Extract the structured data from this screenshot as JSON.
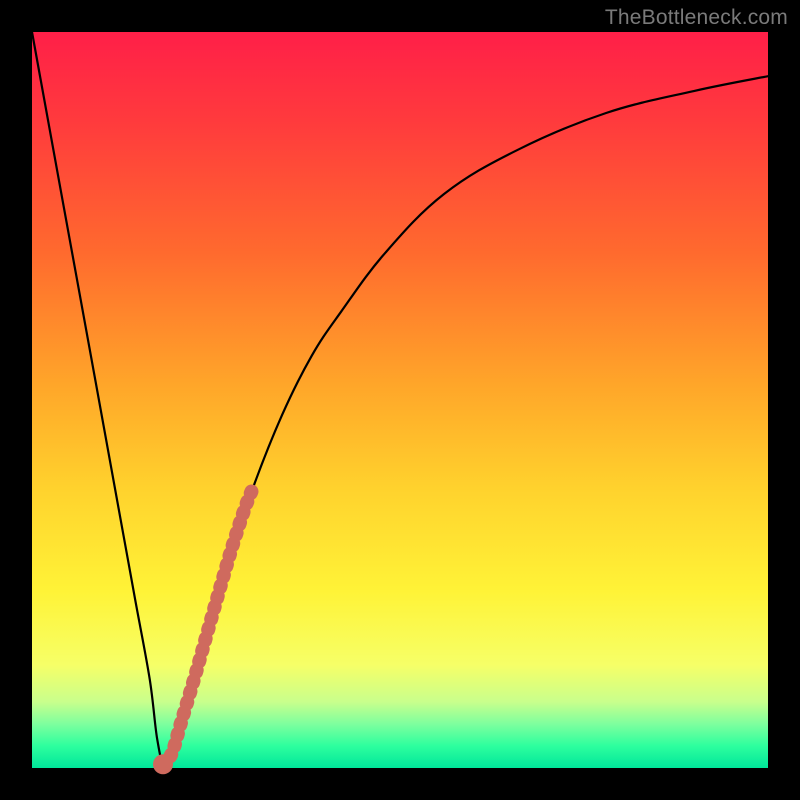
{
  "watermark": "TheBottleneck.com",
  "colors": {
    "frame": "#000000",
    "curve": "#000000",
    "accent_dash": "#cf6a5e",
    "gradient_top": "#ff1f48",
    "gradient_bottom": "#00e69a"
  },
  "chart_data": {
    "type": "line",
    "title": "",
    "xlabel": "",
    "ylabel": "",
    "xlim": [
      0,
      100
    ],
    "ylim": [
      0,
      100
    ],
    "series": [
      {
        "name": "bottleneck-curve",
        "x": [
          0,
          4,
          8,
          12,
          14,
          16,
          17,
          18,
          19,
          22,
          26,
          30,
          34,
          38,
          42,
          48,
          56,
          66,
          78,
          90,
          100
        ],
        "values": [
          100,
          78,
          56,
          34,
          23,
          12,
          4,
          0,
          2,
          12,
          26,
          38,
          48,
          56,
          62,
          70,
          78,
          84,
          89,
          92,
          94
        ]
      }
    ],
    "accent_segment": {
      "name": "highlighted-range",
      "x": [
        17.8,
        19.0,
        20.2,
        22.0,
        24.0,
        26.0,
        27.5,
        29.0,
        30.0
      ],
      "values": [
        0.5,
        2.0,
        6.0,
        12.0,
        19.0,
        26.0,
        31.0,
        35.5,
        38.0
      ]
    }
  }
}
